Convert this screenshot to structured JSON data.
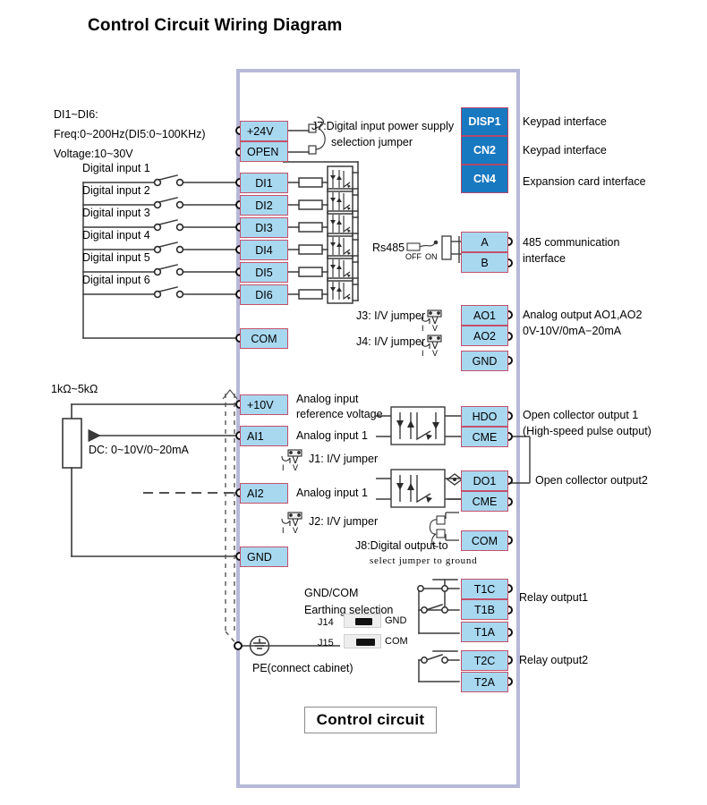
{
  "title": "Control Circuit Wiring Diagram",
  "notes": {
    "di_spec_line1": "DI1~DI6:",
    "di_spec_line2": "Freq:0~200Hz(DI5:0~100KHz)",
    "di_spec_line3": "Voltage:10~30V",
    "pot_spec": "1kΩ~5kΩ",
    "analog_range": "DC: 0~10V/0~20mA",
    "pe_label": "PE(connect cabinet)",
    "earthing_line1": "GND/COM",
    "earthing_line2": "Earthing selection",
    "control_circuit": "Control circuit"
  },
  "jumpers": {
    "j7_line1": "J7:Digital input power supply",
    "j7_line2": "selection jumper",
    "j3": "J3: I/V jumper",
    "j4": "J4: I/V jumper",
    "j1": "J1:  I/V jumper",
    "j2": "J2:  I/V jumper",
    "j8_line1": "J8:Digital output to",
    "j8_line2": "select jumper to ground",
    "j14": "J14",
    "j15": "J15",
    "j14_label": "GND",
    "j15_label": "COM",
    "iv_i": "I",
    "iv_v": "V"
  },
  "rs485": {
    "label": "Rs485",
    "off": "OFF",
    "on": "ON"
  },
  "digital_inputs": [
    {
      "source": "Digital input 1",
      "terminal": "DI1"
    },
    {
      "source": "Digital input 2",
      "terminal": "DI2"
    },
    {
      "source": "Digital input 3",
      "terminal": "DI3"
    },
    {
      "source": "Digital input 4",
      "terminal": "DI4"
    },
    {
      "source": "Digital input 5",
      "terminal": "DI5"
    },
    {
      "source": "Digital input 6",
      "terminal": "DI6"
    }
  ],
  "power_terminals": [
    {
      "label": "+24V"
    },
    {
      "label": "OPEN"
    }
  ],
  "com_terminal": {
    "label": "COM"
  },
  "interfaces": [
    {
      "label": "DISP1",
      "desc": "Keypad interface"
    },
    {
      "label": "CN2",
      "desc": "Keypad interface"
    },
    {
      "label": "CN4",
      "desc": "Expansion card interface"
    }
  ],
  "comm_terminals": [
    {
      "label": "A"
    },
    {
      "label": "B"
    }
  ],
  "comm_desc_line1": "485 communication",
  "comm_desc_line2": "interface",
  "analog_outputs": [
    {
      "label": "AO1"
    },
    {
      "label": "AO2"
    },
    {
      "label": "GND"
    }
  ],
  "analog_output_desc_line1": "Analog output AO1,AO2",
  "analog_output_desc_line2": "0V-10V/0mA−20mA",
  "analog_inputs": [
    {
      "label": "+10V",
      "desc_line1": "Analog input",
      "desc_line2": "reference voltage"
    },
    {
      "label": "AI1",
      "desc_line1": "Analog input 1",
      "desc_line2": ""
    },
    {
      "label": "AI2",
      "desc_line1": "Analog input 1",
      "desc_line2": ""
    },
    {
      "label": "GND",
      "desc_line1": "",
      "desc_line2": ""
    }
  ],
  "open_collector_1": {
    "terminals": [
      {
        "label": "HDO"
      },
      {
        "label": "CME"
      }
    ],
    "desc_line1": "Open collector output 1",
    "desc_line2": "(High-speed pulse output)"
  },
  "open_collector_2": {
    "terminals": [
      {
        "label": "DO1"
      },
      {
        "label": "CME"
      }
    ],
    "desc": "Open collector output2"
  },
  "do_com_terminal": {
    "label": "COM"
  },
  "relay1": {
    "terminals": [
      {
        "label": "T1C"
      },
      {
        "label": "T1B"
      },
      {
        "label": "T1A"
      }
    ],
    "desc": "Relay output1"
  },
  "relay2": {
    "terminals": [
      {
        "label": "T2C"
      },
      {
        "label": "T2A"
      }
    ],
    "desc": "Relay output2"
  },
  "colors": {
    "terminal_fill": "#a8d8f0",
    "terminal_border": "#c4506b",
    "interface_fill": "#1878c0",
    "frame_border": "#b8b8d8",
    "wire": "#3a3a3a"
  }
}
